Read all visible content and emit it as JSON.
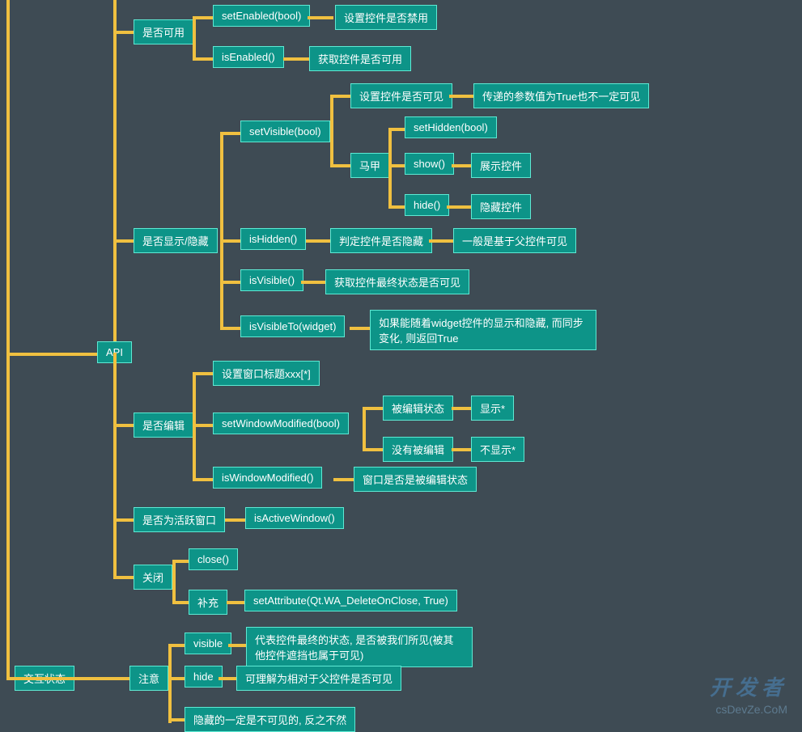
{
  "chart_data": {
    "type": "tree",
    "root": "交互状态",
    "children": [
      {
        "label": "API",
        "children": [
          {
            "label": "是否可用",
            "children": [
              {
                "label": "setEnabled(bool)",
                "note": [
                  "设置控件是否禁用"
                ]
              },
              {
                "label": "isEnabled()",
                "note": [
                  "获取控件是否可用"
                ]
              }
            ]
          },
          {
            "label": "是否显示/隐藏",
            "children": [
              {
                "label": "setVisible(bool)",
                "note": [
                  "设置控件是否可见",
                  "传递的参数值为True也不一定可见"
                ],
                "children": [
                  {
                    "label": "马甲",
                    "children": [
                      {
                        "label": "setHidden(bool)"
                      },
                      {
                        "label": "show()",
                        "note": [
                          "展示控件"
                        ]
                      },
                      {
                        "label": "hide()",
                        "note": [
                          "隐藏控件"
                        ]
                      }
                    ]
                  }
                ]
              },
              {
                "label": "isHidden()",
                "note": [
                  "判定控件是否隐藏",
                  "一般是基于父控件可见"
                ]
              },
              {
                "label": "isVisible()",
                "note": [
                  "获取控件最终状态是否可见"
                ]
              },
              {
                "label": "isVisibleTo(widget)",
                "note": [
                  "如果能随着widget控件的显示和隐藏, 而同步变化, 则返回True"
                ]
              }
            ]
          },
          {
            "label": "是否编辑",
            "children": [
              {
                "label": "设置窗口标题xxx[*]"
              },
              {
                "label": "setWindowModified(bool)",
                "children": [
                  {
                    "label": "被编辑状态",
                    "note": [
                      "显示*"
                    ]
                  },
                  {
                    "label": "没有被编辑",
                    "note": [
                      "不显示*"
                    ]
                  }
                ]
              },
              {
                "label": "isWindowModified()",
                "note": [
                  "窗口是否是被编辑状态"
                ]
              }
            ]
          },
          {
            "label": "是否为活跃窗口",
            "children": [
              {
                "label": "isActiveWindow()"
              }
            ]
          },
          {
            "label": "关闭",
            "children": [
              {
                "label": "close()"
              },
              {
                "label": "补充",
                "children": [
                  {
                    "label": "setAttribute(Qt.WA_DeleteOnClose, True)"
                  }
                ]
              }
            ]
          }
        ]
      },
      {
        "label": "注意",
        "children": [
          {
            "label": "visible",
            "note": [
              "代表控件最终的状态, 是否被我们所见(被其他控件遮挡也属于可见)"
            ]
          },
          {
            "label": "hide",
            "note": [
              "可理解为相对于父控件是否可见"
            ]
          },
          {
            "label": "隐藏的一定是不可见的, 反之不然"
          }
        ]
      }
    ]
  },
  "n": {
    "root": "交互状态",
    "api": "API",
    "usable": "是否可用",
    "setEnabled": "setEnabled(bool)",
    "setEnabled_note": "设置控件是否禁用",
    "isEnabled": "isEnabled()",
    "isEnabled_note": "获取控件是否可用",
    "visible_section": "是否显示/隐藏",
    "setVisible": "setVisible(bool)",
    "setVisible_note1": "设置控件是否可见",
    "setVisible_note2": "传递的参数值为True也不一定可见",
    "alias": "马甲",
    "setHidden": "setHidden(bool)",
    "show": "show()",
    "show_note": "展示控件",
    "hide": "hide()",
    "hide_note": "隐藏控件",
    "isHidden": "isHidden()",
    "isHidden_note1": "判定控件是否隐藏",
    "isHidden_note2": "一般是基于父控件可见",
    "isVisible": "isVisible()",
    "isVisible_note": "获取控件最终状态是否可见",
    "isVisibleTo": "isVisibleTo(widget)",
    "isVisibleTo_note": "如果能随着widget控件的显示和隐藏, 而同步变化, 则返回True",
    "edit_section": "是否编辑",
    "setTitle": "设置窗口标题xxx[*]",
    "setWindowModified": "setWindowModified(bool)",
    "edited": "被编辑状态",
    "edited_note": "显示*",
    "not_edited": "没有被编辑",
    "not_edited_note": "不显示*",
    "isWindowModified": "isWindowModified()",
    "isWindowModified_note": "窗口是否是被编辑状态",
    "active_section": "是否为活跃窗口",
    "isActiveWindow": "isActiveWindow()",
    "close_section": "关闭",
    "close": "close()",
    "supplement": "补充",
    "setAttribute": "setAttribute(Qt.WA_DeleteOnClose, True)",
    "notice": "注意",
    "visible": "visible",
    "visible_note": "代表控件最终的状态, 是否被我们所见(被其他控件遮挡也属于可见)",
    "hide_k": "hide",
    "hide_k_note": "可理解为相对于父控件是否可见",
    "hidden_final": "隐藏的一定是不可见的, 反之不然"
  },
  "watermark": {
    "big": "开发者",
    "small": "csDevZe.CoM"
  }
}
